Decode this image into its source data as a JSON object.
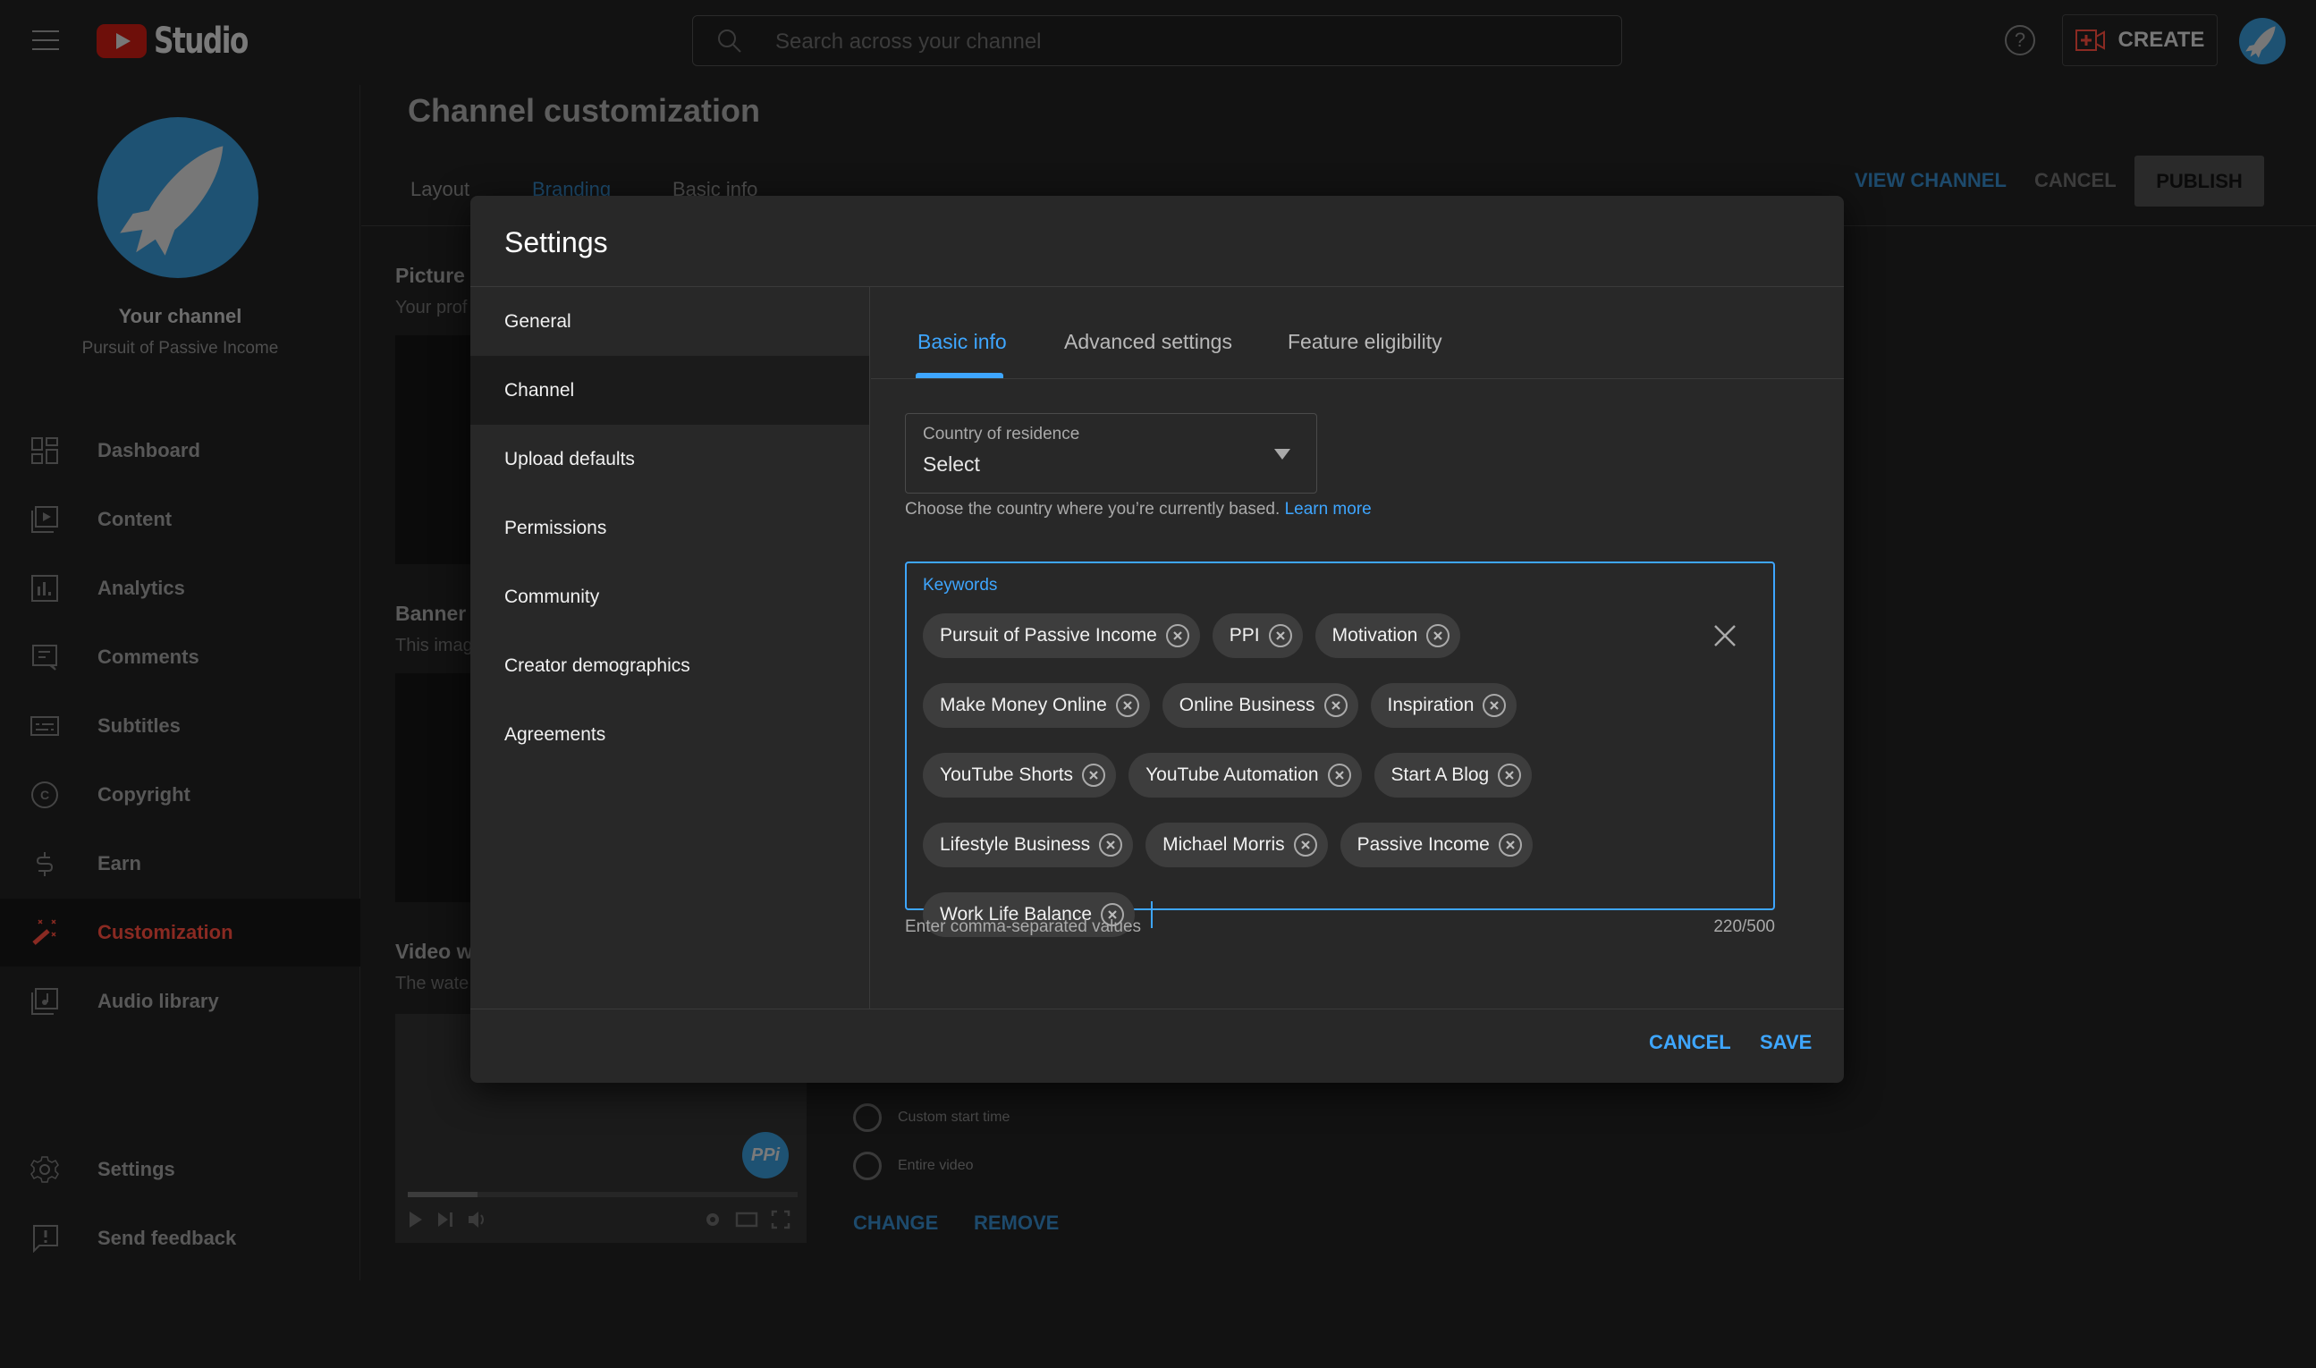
{
  "app": {
    "brand": "Studio",
    "search_placeholder": "Search across your channel",
    "create_label": "CREATE"
  },
  "sidebar": {
    "channel_title": "Your channel",
    "channel_name": "Pursuit of Passive Income",
    "items": [
      {
        "label": "Dashboard",
        "icon": "dashboard-icon",
        "active": false
      },
      {
        "label": "Content",
        "icon": "content-icon",
        "active": false
      },
      {
        "label": "Analytics",
        "icon": "analytics-icon",
        "active": false
      },
      {
        "label": "Comments",
        "icon": "comments-icon",
        "active": false
      },
      {
        "label": "Subtitles",
        "icon": "subtitles-icon",
        "active": false
      },
      {
        "label": "Copyright",
        "icon": "copyright-icon",
        "active": false
      },
      {
        "label": "Earn",
        "icon": "dollar-icon",
        "active": false
      },
      {
        "label": "Customization",
        "icon": "magic-wand-icon",
        "active": true
      },
      {
        "label": "Audio library",
        "icon": "audio-library-icon",
        "active": false
      }
    ],
    "bottom_items": [
      {
        "label": "Settings",
        "icon": "gear-icon"
      },
      {
        "label": "Send feedback",
        "icon": "feedback-icon"
      }
    ]
  },
  "page": {
    "title": "Channel customization",
    "tabs": [
      {
        "label": "Layout",
        "active": false
      },
      {
        "label": "Branding",
        "active": true
      },
      {
        "label": "Basic info",
        "active": false
      }
    ],
    "view_channel_label": "VIEW CHANNEL",
    "cancel_label": "CANCEL",
    "publish_label": "PUBLISH",
    "sections": {
      "picture_title": "Picture",
      "picture_sub": "Your prof",
      "banner_title": "Banner i",
      "banner_sub": "This imag",
      "watermark_title": "Video w",
      "watermark_sub": "The wate"
    },
    "watermark": {
      "logo_text": "PPi",
      "progress_fraction": 0.18,
      "options": [
        "Custom start time",
        "Entire video"
      ],
      "change_label": "CHANGE",
      "remove_label": "REMOVE"
    }
  },
  "dialog": {
    "title": "Settings",
    "nav": [
      {
        "label": "General",
        "active": false
      },
      {
        "label": "Channel",
        "active": true
      },
      {
        "label": "Upload defaults",
        "active": false
      },
      {
        "label": "Permissions",
        "active": false
      },
      {
        "label": "Community",
        "active": false
      },
      {
        "label": "Creator demographics",
        "active": false
      },
      {
        "label": "Agreements",
        "active": false
      }
    ],
    "tabs": [
      {
        "label": "Basic info",
        "active": true
      },
      {
        "label": "Advanced settings",
        "active": false
      },
      {
        "label": "Feature eligibility",
        "active": false
      }
    ],
    "country": {
      "label": "Country of residence",
      "value": "Select",
      "help_text": "Choose the country where you’re currently based.",
      "learn_more": "Learn more"
    },
    "keywords": {
      "label": "Keywords",
      "values": [
        "Pursuit of Passive Income",
        "PPI",
        "Motivation",
        "Make Money Online",
        "Online Business",
        "Inspiration",
        "YouTube Shorts",
        "YouTube Automation",
        "Start A Blog",
        "Lifestyle Business",
        "Michael Morris",
        "Passive Income",
        "Work Life Balance"
      ],
      "input_value": "",
      "hint": "Enter comma-separated values",
      "count": "220/500"
    },
    "cancel_label": "CANCEL",
    "save_label": "SAVE"
  },
  "colors": {
    "accent_blue": "#3ea6ff",
    "brand_red": "#ff0000",
    "dialog_bg": "#282828",
    "chip_bg": "#3d3d3d"
  }
}
